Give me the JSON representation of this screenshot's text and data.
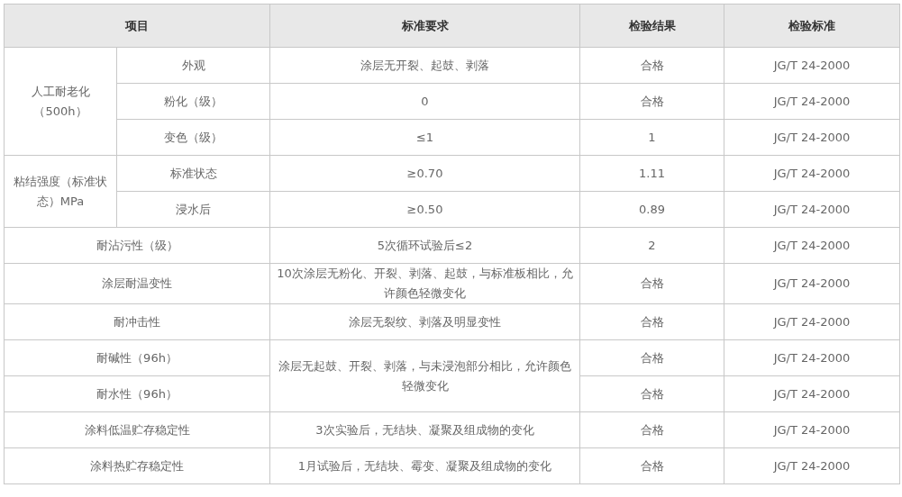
{
  "table": {
    "columns": [
      {
        "text": "项目",
        "colspan": 2
      },
      {
        "text": "标准要求"
      },
      {
        "text": "检验结果"
      },
      {
        "text": "检验标准"
      }
    ],
    "rows": [
      [
        {
          "text": "人工耐老化（500h）",
          "rowspan": 3
        },
        {
          "text": "外观"
        },
        {
          "text": "涂层无开裂、起鼓、剥落"
        },
        {
          "text": "合格"
        },
        {
          "text": "JG/T  24-2000"
        }
      ],
      [
        {
          "text": "粉化（级）"
        },
        {
          "text": "0"
        },
        {
          "text": "合格"
        },
        {
          "text": "JG/T  24-2000"
        }
      ],
      [
        {
          "text": "变色（级）"
        },
        {
          "text": "≤1"
        },
        {
          "text": "1"
        },
        {
          "text": "JG/T  24-2000"
        }
      ],
      [
        {
          "text": "粘结强度（标准状态）MPa",
          "rowspan": 2
        },
        {
          "text": "标准状态"
        },
        {
          "text": "≥0.70"
        },
        {
          "text": "1.11"
        },
        {
          "text": "JG/T  24-2000"
        }
      ],
      [
        {
          "text": "浸水后"
        },
        {
          "text": "≥0.50"
        },
        {
          "text": "0.89"
        },
        {
          "text": "JG/T  24-2000"
        }
      ],
      [
        {
          "text": "耐沾污性（级）",
          "colspan": 2
        },
        {
          "text": "5次循环试验后≤2"
        },
        {
          "text": "2"
        },
        {
          "text": "JG/T  24-2000"
        }
      ],
      [
        {
          "text": "涂层耐温变性",
          "colspan": 2
        },
        {
          "text": "10次涂层无粉化、开裂、剥落、起鼓，与标准板相比，允许颜色轻微变化"
        },
        {
          "text": "合格"
        },
        {
          "text": "JG/T  24-2000"
        }
      ],
      [
        {
          "text": "耐冲击性",
          "colspan": 2
        },
        {
          "text": "涂层无裂纹、剥落及明显变性"
        },
        {
          "text": "合格"
        },
        {
          "text": "JG/T  24-2000"
        }
      ],
      [
        {
          "text": "耐碱性（96h）",
          "colspan": 2
        },
        {
          "text": "涂层无起鼓、开裂、剥落，与未浸泡部分相比，允许颜色轻微变化",
          "rowspan": 2
        },
        {
          "text": "合格"
        },
        {
          "text": "JG/T  24-2000"
        }
      ],
      [
        {
          "text": "耐水性（96h）",
          "colspan": 2
        },
        {
          "text": "合格"
        },
        {
          "text": "JG/T  24-2000"
        }
      ],
      [
        {
          "text": "涂料低温贮存稳定性",
          "colspan": 2
        },
        {
          "text": "3次实验后，无结块、凝聚及组成物的变化"
        },
        {
          "text": "合格"
        },
        {
          "text": "JG/T  24-2000"
        }
      ],
      [
        {
          "text": "涂料热贮存稳定性",
          "colspan": 2
        },
        {
          "text": "1月试验后，无结块、霉变、凝聚及组成物的变化"
        },
        {
          "text": "合格"
        },
        {
          "text": "JG/T  24-2000"
        }
      ]
    ]
  }
}
